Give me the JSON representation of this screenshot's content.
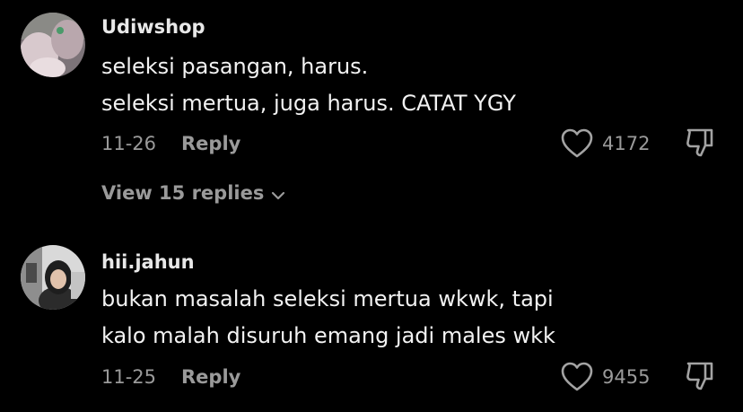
{
  "comments": [
    {
      "username": "Udiwshop",
      "lines": [
        "seleksi pasangan, harus.",
        "seleksi mertua, juga harus. CATAT YGY"
      ],
      "date": "11-26",
      "reply_label": "Reply",
      "like_count": "4172",
      "view_replies_label": "View 15 replies"
    },
    {
      "username": "hii.jahun",
      "lines": [
        "bukan masalah seleksi mertua wkwk, tapi",
        "kalo malah disuruh emang jadi males wkk"
      ],
      "date": "11-25",
      "reply_label": "Reply",
      "like_count": "9455"
    }
  ],
  "icons": {
    "like": "heart-outline-icon",
    "dislike": "thumbs-down-outline-icon",
    "view_replies": "chevron-down-icon"
  },
  "colors": {
    "background": "#000000",
    "text_primary": "#f2f2f2",
    "text_secondary": "#9a9a9a"
  }
}
